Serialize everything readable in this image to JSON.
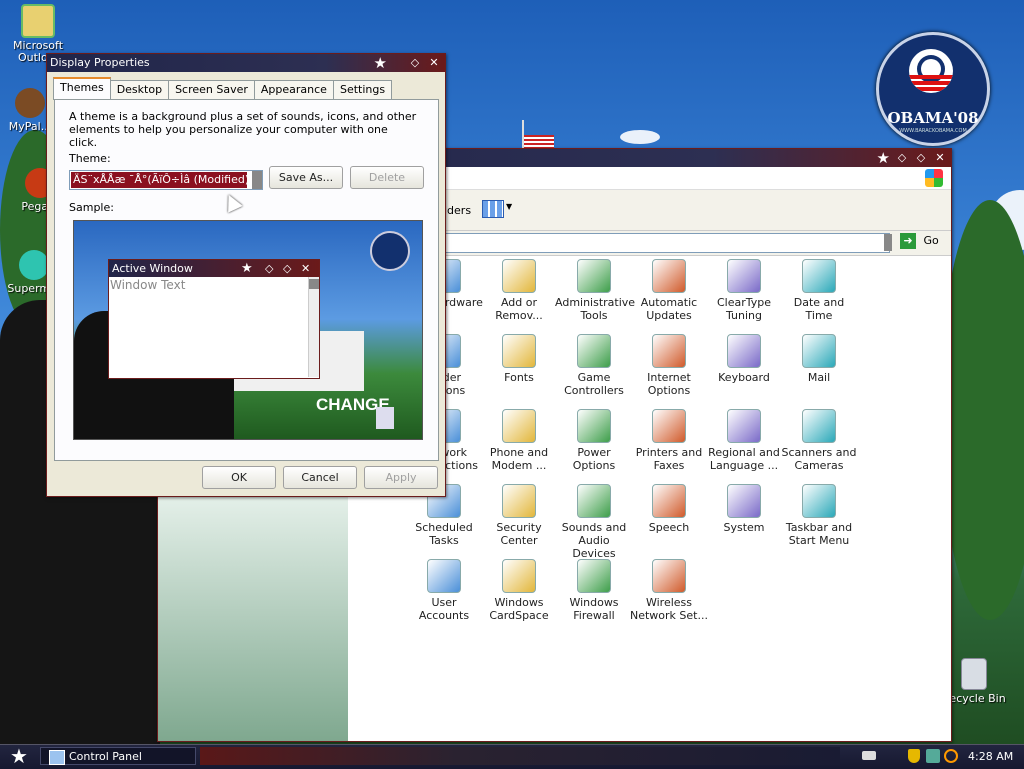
{
  "desktop": {
    "icons": [
      {
        "label": "Microsoft Outlo..."
      },
      {
        "label": "MyPal..."
      },
      {
        "label": "Pega..."
      },
      {
        "label": "Superm..."
      },
      {
        "label": "Recycle Bin"
      }
    ],
    "logo": {
      "text": "OBAMA'08",
      "subtext": "WWW.BARACKOBAMA.COM"
    }
  },
  "control_panel": {
    "toolbar_folders_label": "lders",
    "go_label": "Go",
    "items": [
      {
        "label": "Add Hardware",
        "icon": "add-hardware-icon"
      },
      {
        "label": "Add or Remov...",
        "icon": "add-remove-programs-icon"
      },
      {
        "label": "Administrative Tools",
        "icon": "administrative-tools-icon"
      },
      {
        "label": "Automatic Updates",
        "icon": "automatic-updates-icon"
      },
      {
        "label": "ClearType Tuning",
        "icon": "cleartype-tuning-icon"
      },
      {
        "label": "Date and Time",
        "icon": "date-time-icon"
      },
      {
        "label": "Folder Options",
        "icon": "folder-options-icon"
      },
      {
        "label": "Fonts",
        "icon": "fonts-icon"
      },
      {
        "label": "Game Controllers",
        "icon": "game-controllers-icon"
      },
      {
        "label": "Internet Options",
        "icon": "internet-options-icon"
      },
      {
        "label": "Keyboard",
        "icon": "keyboard-icon"
      },
      {
        "label": "Mail",
        "icon": "mail-icon"
      },
      {
        "label": "Network Connections",
        "icon": "network-connections-icon"
      },
      {
        "label": "Phone and Modem ...",
        "icon": "phone-modem-icon"
      },
      {
        "label": "Power Options",
        "icon": "power-options-icon"
      },
      {
        "label": "Printers and Faxes",
        "icon": "printers-faxes-icon"
      },
      {
        "label": "Regional and Language ...",
        "icon": "regional-language-icon"
      },
      {
        "label": "Scanners and Cameras",
        "icon": "scanners-cameras-icon"
      },
      {
        "label": "Scheduled Tasks",
        "icon": "scheduled-tasks-icon"
      },
      {
        "label": "Security Center",
        "icon": "security-center-icon"
      },
      {
        "label": "Sounds and Audio Devices",
        "icon": "sounds-audio-icon"
      },
      {
        "label": "Speech",
        "icon": "speech-icon"
      },
      {
        "label": "System",
        "icon": "system-icon"
      },
      {
        "label": "Taskbar and Start Menu",
        "icon": "taskbar-start-menu-icon"
      },
      {
        "label": "User Accounts",
        "icon": "user-accounts-icon"
      },
      {
        "label": "Windows CardSpace",
        "icon": "windows-cardspace-icon"
      },
      {
        "label": "Windows Firewall",
        "icon": "windows-firewall-icon"
      },
      {
        "label": "Wireless Network Set...",
        "icon": "wireless-network-icon"
      }
    ]
  },
  "display_properties": {
    "title": "Display Properties",
    "tabs": [
      "Themes",
      "Desktop",
      "Screen Saver",
      "Appearance",
      "Settings"
    ],
    "description": "A theme is a background plus a set of sounds, icons, and other elements to help you personalize your computer with one click.",
    "theme_label": "Theme:",
    "theme_value": "ÄS¨xÅÅæ ¯Å°(ÃïÔ÷Ìâ (Modified)",
    "save_as_label": "Save As...",
    "delete_label": "Delete",
    "sample_label": "Sample:",
    "sample_window_title": "Active Window",
    "sample_window_text": "Window Text",
    "sample_change_text": "CHANGE",
    "ok_label": "OK",
    "cancel_label": "Cancel",
    "apply_label": "Apply"
  },
  "taskbar": {
    "task_label": "Control Panel",
    "clock": "4:28 AM"
  },
  "colors": {
    "title_bar_dark": "#20254a",
    "title_bar_red": "#6b1a1a",
    "theme_select_bg": "#8b1020",
    "tab_highlight": "#e68b2c"
  }
}
